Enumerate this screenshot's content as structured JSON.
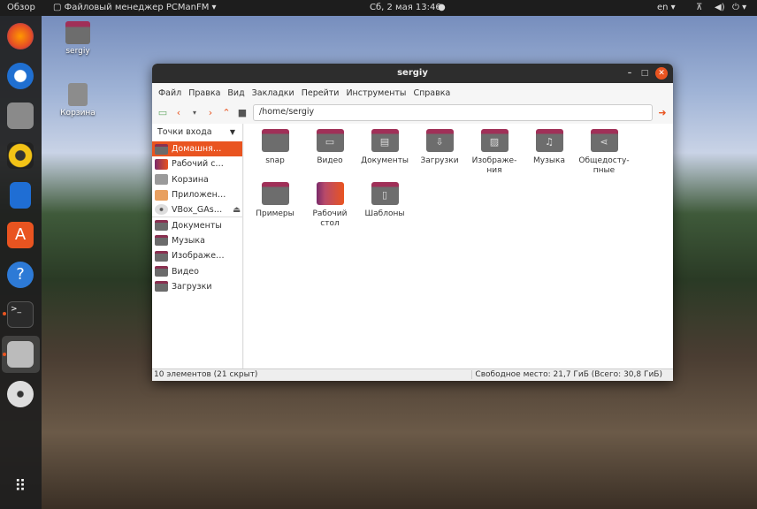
{
  "topbar": {
    "overview": "Обзор",
    "app": "Файловый менеджер PCManFM",
    "clock": "Сб, 2 мая  13:46",
    "lang": "en"
  },
  "desktop": [
    {
      "label": "sergiy"
    },
    {
      "label": "Корзина"
    }
  ],
  "window": {
    "title": "sergiy",
    "menu": [
      "Файл",
      "Правка",
      "Вид",
      "Закладки",
      "Перейти",
      "Инструменты",
      "Справка"
    ],
    "path": "/home/sergiy",
    "sidebar_header": "Точки входа",
    "places": [
      "Домашня…",
      "Рабочий с…",
      "Корзина",
      "Приложен…",
      "VBox_GAs…"
    ],
    "bookmarks": [
      "Документы",
      "Музыка",
      "Изображе…",
      "Видео",
      "Загрузки"
    ],
    "files": [
      {
        "name": "snap",
        "icon": ""
      },
      {
        "name": "Видео",
        "icon": "▭"
      },
      {
        "name": "Документы",
        "icon": "▤"
      },
      {
        "name": "Загрузки",
        "icon": "⇩"
      },
      {
        "name": "Изображе-ния",
        "icon": "▨"
      },
      {
        "name": "Музыка",
        "icon": "♫"
      },
      {
        "name": "Общедосту-пные",
        "icon": "⋖"
      },
      {
        "name": "Примеры",
        "icon": ""
      },
      {
        "name": "Рабочий стол",
        "icon": ""
      },
      {
        "name": "Шаблоны",
        "icon": "▯"
      }
    ],
    "status_left": "10 элементов (21 скрыт)",
    "status_right": "Свободное место: 21,7 ГиБ (Всего: 30,8 ГиБ)"
  }
}
